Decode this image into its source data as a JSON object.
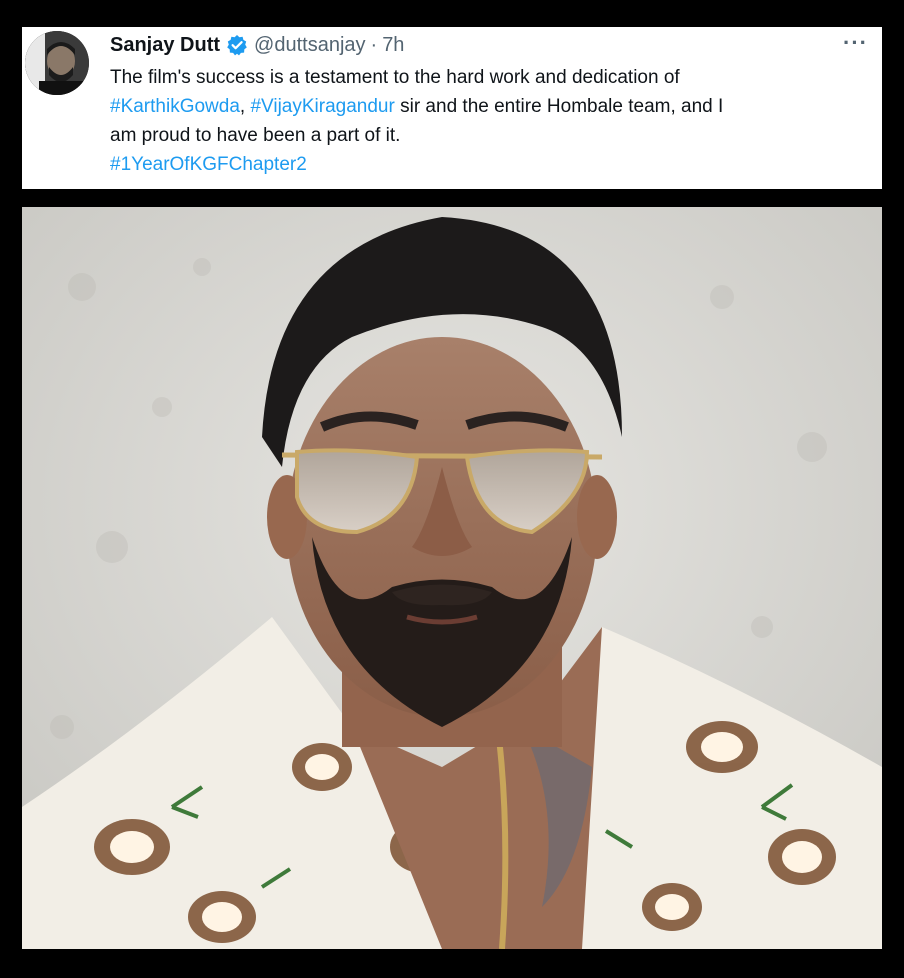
{
  "tweet": {
    "author": {
      "display_name": "Sanjay Dutt",
      "handle": "@duttsanjay",
      "verified": true,
      "avatar_icon": "profile-photo"
    },
    "separator": "·",
    "timestamp": "7h",
    "more_icon": "more-horizontal-icon",
    "text": {
      "line1": "The film's success is a testament to the hard work and dedication of",
      "hashtag1": "#KarthikGowda",
      "comma": ", ",
      "hashtag2": "#VijayKiragandur",
      "line2_rest": " sir and the entire Hombale team, and I",
      "line3": "am proud to have been a part of it.",
      "hashtag3": "#1YearOfKGFChapter2"
    },
    "colors": {
      "link": "#1d9bf0",
      "verified": "#1d9bf0",
      "text": "#0f1419",
      "muted": "#536471"
    }
  },
  "media": {
    "type": "photo",
    "subject": "portrait-photo"
  }
}
